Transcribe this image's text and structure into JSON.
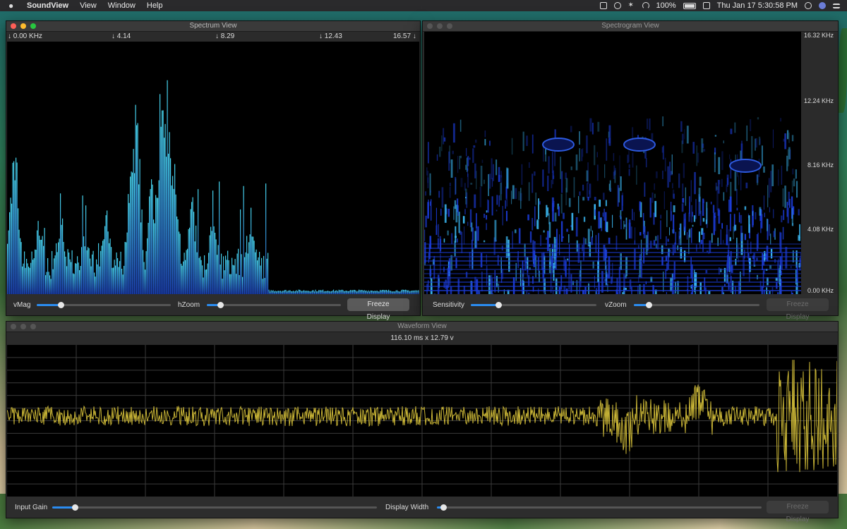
{
  "menubar": {
    "app_name": "SoundView",
    "menus": [
      "View",
      "Window",
      "Help"
    ],
    "battery": "100%",
    "datetime": "Thu Jan 17  5:30:58 PM"
  },
  "spectrum": {
    "title": "Spectrum View",
    "freq_markers": [
      "↓ 0.00 KHz",
      "↓ 4.14",
      "↓ 8.29",
      "↓ 12.43",
      "16.57 ↓"
    ],
    "vmag_label": "vMag",
    "vmag_value": 0.18,
    "hzoom_label": "hZoom",
    "hzoom_value": 0.1,
    "freeze_label": "Freeze Display",
    "bar_color": "#29b6e6"
  },
  "spectrogram": {
    "title": "Spectrogram View",
    "axis_labels": [
      "16.32 KHz",
      "12.24 KHz",
      "8.16 KHz",
      "4.08 KHz",
      "0.00 KHz"
    ],
    "sensitivity_label": "Sensitivity",
    "sensitivity_value": 0.22,
    "vzoom_label": "vZoom",
    "vzoom_value": 0.12,
    "freeze_label": "Freeze Display",
    "tint": "#1b3bd6"
  },
  "waveform": {
    "title": "Waveform View",
    "scale_readout": "116.10 ms x 12.79 v",
    "input_gain_label": "Input Gain",
    "input_gain_value": 0.07,
    "display_width_label": "Display Width",
    "display_width_value": 0.02,
    "freeze_label": "Freeze Display",
    "wave_color": "#c9b536"
  }
}
